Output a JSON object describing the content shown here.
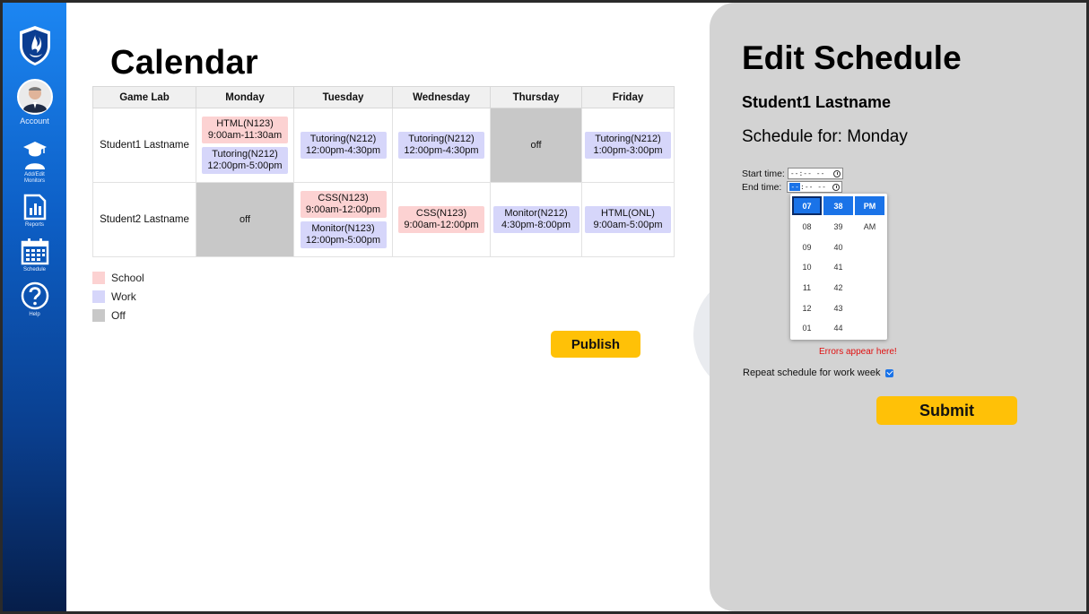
{
  "sidebar": {
    "account_label": "Account",
    "monitors_label": "Add/Edit Monitors",
    "reports_label": "Reports",
    "schedule_label": "Schedule",
    "help_label": "Help"
  },
  "calendar": {
    "title": "Calendar",
    "headers": [
      "Game Lab",
      "Monday",
      "Tuesday",
      "Wednesday",
      "Thursday",
      "Friday"
    ],
    "rows": [
      {
        "name": "Student1 Lastname",
        "monday": [
          {
            "line1": "HTML(N123)",
            "line2": "9:00am-11:30am",
            "kind": "school"
          },
          {
            "line1": "Tutoring(N212)",
            "line2": "12:00pm-5:00pm",
            "kind": "work"
          }
        ],
        "tuesday": [
          {
            "line1": "Tutoring(N212)",
            "line2": "12:00pm-4:30pm",
            "kind": "work"
          }
        ],
        "wednesday": [
          {
            "line1": "Tutoring(N212)",
            "line2": "12:00pm-4:30pm",
            "kind": "work"
          }
        ],
        "thursday_off": "off",
        "friday": [
          {
            "line1": "Tutoring(N212)",
            "line2": "1:00pm-3:00pm",
            "kind": "work"
          }
        ]
      },
      {
        "name": "Student2 Lastname",
        "monday_off": "off",
        "tuesday": [
          {
            "line1": "CSS(N123)",
            "line2": "9:00am-12:00pm",
            "kind": "school"
          },
          {
            "line1": "Monitor(N123)",
            "line2": "12:00pm-5:00pm",
            "kind": "work"
          }
        ],
        "wednesday": [
          {
            "line1": "CSS(N123)",
            "line2": "9:00am-12:00pm",
            "kind": "school"
          }
        ],
        "thursday": [
          {
            "line1": "Monitor(N212)",
            "line2": "4:30pm-8:00pm",
            "kind": "work"
          }
        ],
        "friday": [
          {
            "line1": "HTML(ONL)",
            "line2": "9:00am-5:00pm",
            "kind": "work"
          }
        ]
      }
    ],
    "legend": [
      {
        "label": "School",
        "color": "#fcd2d2"
      },
      {
        "label": "Work",
        "color": "#d6d6fa"
      },
      {
        "label": "Off",
        "color": "#c8c8c8"
      }
    ],
    "publish_label": "Publish"
  },
  "edit": {
    "title": "Edit Schedule",
    "student": "Student1 Lastname",
    "schedule_for": "Schedule for: Monday",
    "start_label": "Start time:",
    "start_value": "--:-- --",
    "end_label": "End time:",
    "end_hour": "--",
    "end_rest": ":-- --",
    "picker": {
      "hours": [
        "07",
        "08",
        "09",
        "10",
        "11",
        "12",
        "01"
      ],
      "minutes": [
        "38",
        "39",
        "40",
        "41",
        "42",
        "43",
        "44"
      ],
      "ampm": [
        "PM",
        "AM"
      ]
    },
    "errors": "Errors appear here!",
    "repeat_label": "Repeat schedule for work week",
    "submit_label": "Submit"
  },
  "colors": {
    "accent": "#1a73e8",
    "button": "#ffc107",
    "error": "#e01010"
  }
}
